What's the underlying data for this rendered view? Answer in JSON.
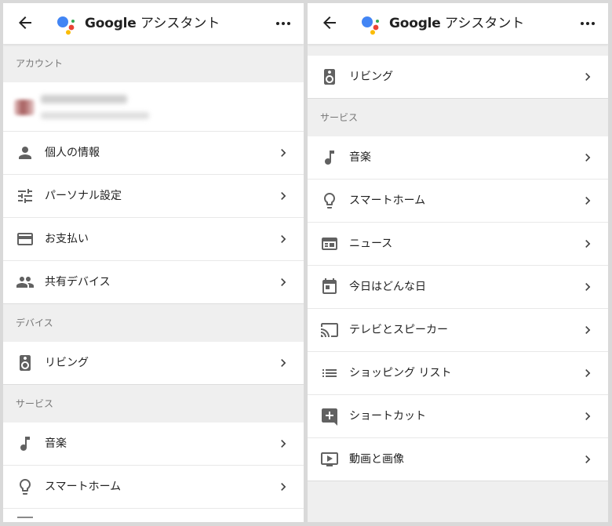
{
  "app": {
    "title_brand": "Google",
    "title_rest": " アシスタント"
  },
  "left": {
    "sections": {
      "account": "アカウント",
      "devices": "デバイス",
      "services": "サービス"
    },
    "account_items": [
      {
        "label": "個人の情報",
        "icon": "person-icon"
      },
      {
        "label": "パーソナル設定",
        "icon": "tune-icon"
      },
      {
        "label": "お支払い",
        "icon": "credit-card-icon"
      },
      {
        "label": "共有デバイス",
        "icon": "people-icon"
      }
    ],
    "device_items": [
      {
        "label": "リビング",
        "icon": "speaker-icon"
      }
    ],
    "service_items": [
      {
        "label": "音楽",
        "icon": "music-note-icon"
      },
      {
        "label": "スマートホーム",
        "icon": "lightbulb-icon"
      }
    ]
  },
  "right": {
    "device_items": [
      {
        "label": "リビング",
        "icon": "speaker-icon"
      }
    ],
    "sections": {
      "services": "サービス"
    },
    "service_items": [
      {
        "label": "音楽",
        "icon": "music-note-icon"
      },
      {
        "label": "スマートホーム",
        "icon": "lightbulb-icon"
      },
      {
        "label": "ニュース",
        "icon": "news-icon"
      },
      {
        "label": "今日はどんな日",
        "icon": "calendar-icon"
      },
      {
        "label": "テレビとスピーカー",
        "icon": "cast-icon"
      },
      {
        "label": "ショッピング リスト",
        "icon": "list-icon"
      },
      {
        "label": "ショートカット",
        "icon": "shortcut-add-icon"
      },
      {
        "label": "動画と画像",
        "icon": "video-icon"
      }
    ]
  }
}
